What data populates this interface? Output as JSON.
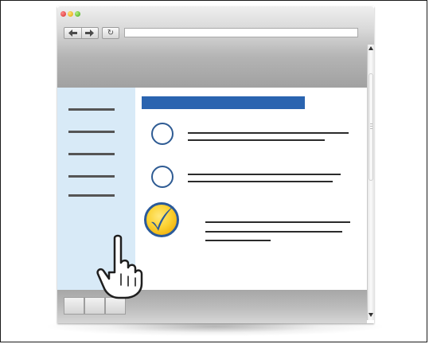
{
  "icons": {
    "window_controls": [
      "close-icon",
      "minimize-icon",
      "zoom-icon"
    ],
    "back": "arrow-left-icon",
    "forward": "arrow-right-icon",
    "reload": "reload-icon",
    "cursor": "hand-pointer-icon",
    "checkmark": "checkmark-icon"
  },
  "toolbar": {
    "back_glyph": "◆",
    "forward_glyph": "◆",
    "reload_glyph": "↻",
    "address_value": ""
  },
  "colors": {
    "heading_accent": "#2a64b0",
    "sidebar_background": "#d8eaf7",
    "radio_border": "#2e5b93",
    "checked_fill": "#fbd233",
    "checkmark": "#2a5a9a"
  },
  "sidebar": {
    "items": [
      {
        "label": ""
      },
      {
        "label": ""
      },
      {
        "label": ""
      },
      {
        "label": ""
      },
      {
        "label": ""
      }
    ]
  },
  "main": {
    "heading": "",
    "options": [
      {
        "label": "",
        "selected": false
      },
      {
        "label": "",
        "selected": false
      },
      {
        "label": "",
        "selected": true
      }
    ]
  },
  "footer": {
    "buttons": [
      {
        "label": ""
      },
      {
        "label": ""
      },
      {
        "label": ""
      }
    ]
  }
}
